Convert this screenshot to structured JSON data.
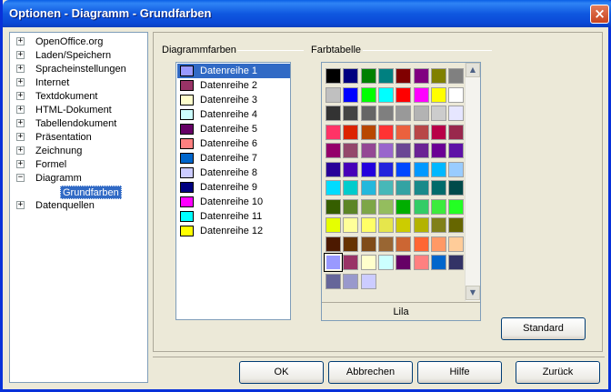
{
  "window": {
    "title": "Optionen - Diagramm - Grundfarben",
    "close_label": "×"
  },
  "tree": {
    "items": [
      {
        "label": "OpenOffice.org",
        "expander": "+"
      },
      {
        "label": "Laden/Speichern",
        "expander": "+"
      },
      {
        "label": "Spracheinstellungen",
        "expander": "+"
      },
      {
        "label": "Internet",
        "expander": "+"
      },
      {
        "label": "Textdokument",
        "expander": "+"
      },
      {
        "label": "HTML-Dokument",
        "expander": "+"
      },
      {
        "label": "Tabellendokument",
        "expander": "+"
      },
      {
        "label": "Präsentation",
        "expander": "+"
      },
      {
        "label": "Zeichnung",
        "expander": "+"
      },
      {
        "label": "Formel",
        "expander": "+"
      },
      {
        "label": "Diagramm",
        "expander": "−"
      },
      {
        "label": "Datenquellen",
        "expander": "+"
      }
    ],
    "selected_subitem": "Grundfarben"
  },
  "chart_colors": {
    "group_label": "Diagrammfarben",
    "rows": [
      {
        "label": "Datenreihe 1",
        "color": "#9999ff"
      },
      {
        "label": "Datenreihe 2",
        "color": "#993366"
      },
      {
        "label": "Datenreihe 3",
        "color": "#ffffcc"
      },
      {
        "label": "Datenreihe 4",
        "color": "#ccffff"
      },
      {
        "label": "Datenreihe 5",
        "color": "#660066"
      },
      {
        "label": "Datenreihe 6",
        "color": "#ff8080"
      },
      {
        "label": "Datenreihe 7",
        "color": "#0066cc"
      },
      {
        "label": "Datenreihe 8",
        "color": "#ccccff"
      },
      {
        "label": "Datenreihe 9",
        "color": "#000080"
      },
      {
        "label": "Datenreihe 10",
        "color": "#ff00ff"
      },
      {
        "label": "Datenreihe 11",
        "color": "#00ffff"
      },
      {
        "label": "Datenreihe 12",
        "color": "#ffff00"
      }
    ]
  },
  "palette": {
    "group_label": "Farbtabelle",
    "selected_name": "Lila",
    "colors": [
      [
        "#000000",
        "#000080",
        "#008000",
        "#008080",
        "#800000",
        "#800080",
        "#808000",
        "#808080"
      ],
      [
        "#c0c0c0",
        "#0000ff",
        "#00ff00",
        "#00ffff",
        "#ff0000",
        "#ff00ff",
        "#ffff00",
        "#ffffff"
      ],
      [
        "#333333",
        "#444444",
        "#666666",
        "#7f7f7f",
        "#999999",
        "#b3b3b3",
        "#cccccc",
        "#e6e6ff"
      ],
      [
        "#ff3366",
        "#dc2300",
        "#b84700",
        "#ff3333",
        "#eb613d",
        "#b84747",
        "#b80047",
        "#99284d"
      ],
      [
        "#94006b",
        "#94476b",
        "#944794",
        "#9966cc",
        "#6b4794",
        "#6b2394",
        "#6b0094",
        "#5e11a6"
      ],
      [
        "#280099",
        "#4700b8",
        "#2300dc",
        "#2323dc",
        "#0047ff",
        "#0099ff",
        "#00b8ff",
        "#99ccff"
      ],
      [
        "#00dcff",
        "#00cccc",
        "#23b8dc",
        "#47b8b8",
        "#33a3a3",
        "#198a8a",
        "#006b6b",
        "#004a4a"
      ],
      [
        "#355e00",
        "#5c8526",
        "#7da647",
        "#94bd5e",
        "#00ae00",
        "#33cc66",
        "#3deb3d",
        "#23ff23"
      ],
      [
        "#e6ff00",
        "#ffff99",
        "#ffff66",
        "#e6e64c",
        "#cccc00",
        "#b3b300",
        "#808019",
        "#666600"
      ],
      [
        "#4c1900",
        "#663300",
        "#804c19",
        "#996633",
        "#cc6633",
        "#ff6633",
        "#ff9966",
        "#ffcc99"
      ],
      [
        "#9999ff",
        "#993366",
        "#ffffcc",
        "#ccffff",
        "#660066",
        "#ff8080",
        "#0066cc",
        "#333366"
      ],
      [
        "#666699",
        "#9999cc",
        "#ccccff"
      ]
    ],
    "selected_index": [
      10,
      0
    ]
  },
  "buttons": {
    "standard": "Standard",
    "ok": "OK",
    "cancel": "Abbrechen",
    "help": "Hilfe",
    "back": "Zurück"
  }
}
